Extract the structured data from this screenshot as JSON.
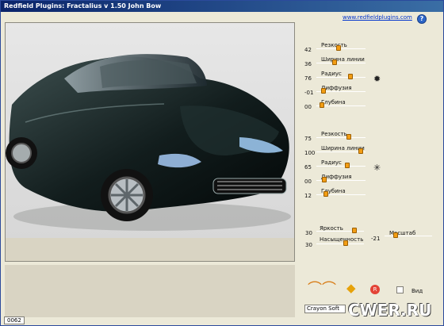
{
  "window": {
    "title": "Redfield Plugins: Fractalius v 1.50    John Bow"
  },
  "header": {
    "link": "www.redfieldplugins.com",
    "help_icon": "?"
  },
  "preview": {
    "description": "dark green Aston Martin Rapide studio photo"
  },
  "groups": [
    {
      "items": [
        {
          "label": "Резкость",
          "value": "42",
          "fill": 0.45
        },
        {
          "label": "Ширина линии",
          "value": "36",
          "fill": 0.35
        },
        {
          "label": "Радиус",
          "value": "76",
          "fill": 0.72
        },
        {
          "label": "Диффузия",
          "value": "-01",
          "fill": 0.1
        },
        {
          "label": "Глубина",
          "value": "00",
          "fill": 0.07
        }
      ],
      "icon": "gear-icon"
    },
    {
      "items": [
        {
          "label": "Резкость",
          "value": "75",
          "fill": 0.68
        },
        {
          "label": "Ширина линии",
          "value": "100",
          "fill": 0.95
        },
        {
          "label": "Радиус",
          "value": "65",
          "fill": 0.64
        },
        {
          "label": "Диффузия",
          "value": "00",
          "fill": 0.12
        },
        {
          "label": "Глубина",
          "value": "12",
          "fill": 0.16
        }
      ],
      "icon": "star-icon"
    }
  ],
  "bottom": {
    "brightness": {
      "label": "Яркость",
      "value": "30",
      "fill": 0.8
    },
    "saturation": {
      "label": "Насыщенность",
      "value": "30",
      "fill": 0.6
    },
    "scale": {
      "label": "Масштаб",
      "value": "-21",
      "fill": 0.2
    },
    "view_label": "Вид",
    "preset": "Crayon Soft",
    "frame": "0062"
  },
  "watermark": "CWER.RU"
}
